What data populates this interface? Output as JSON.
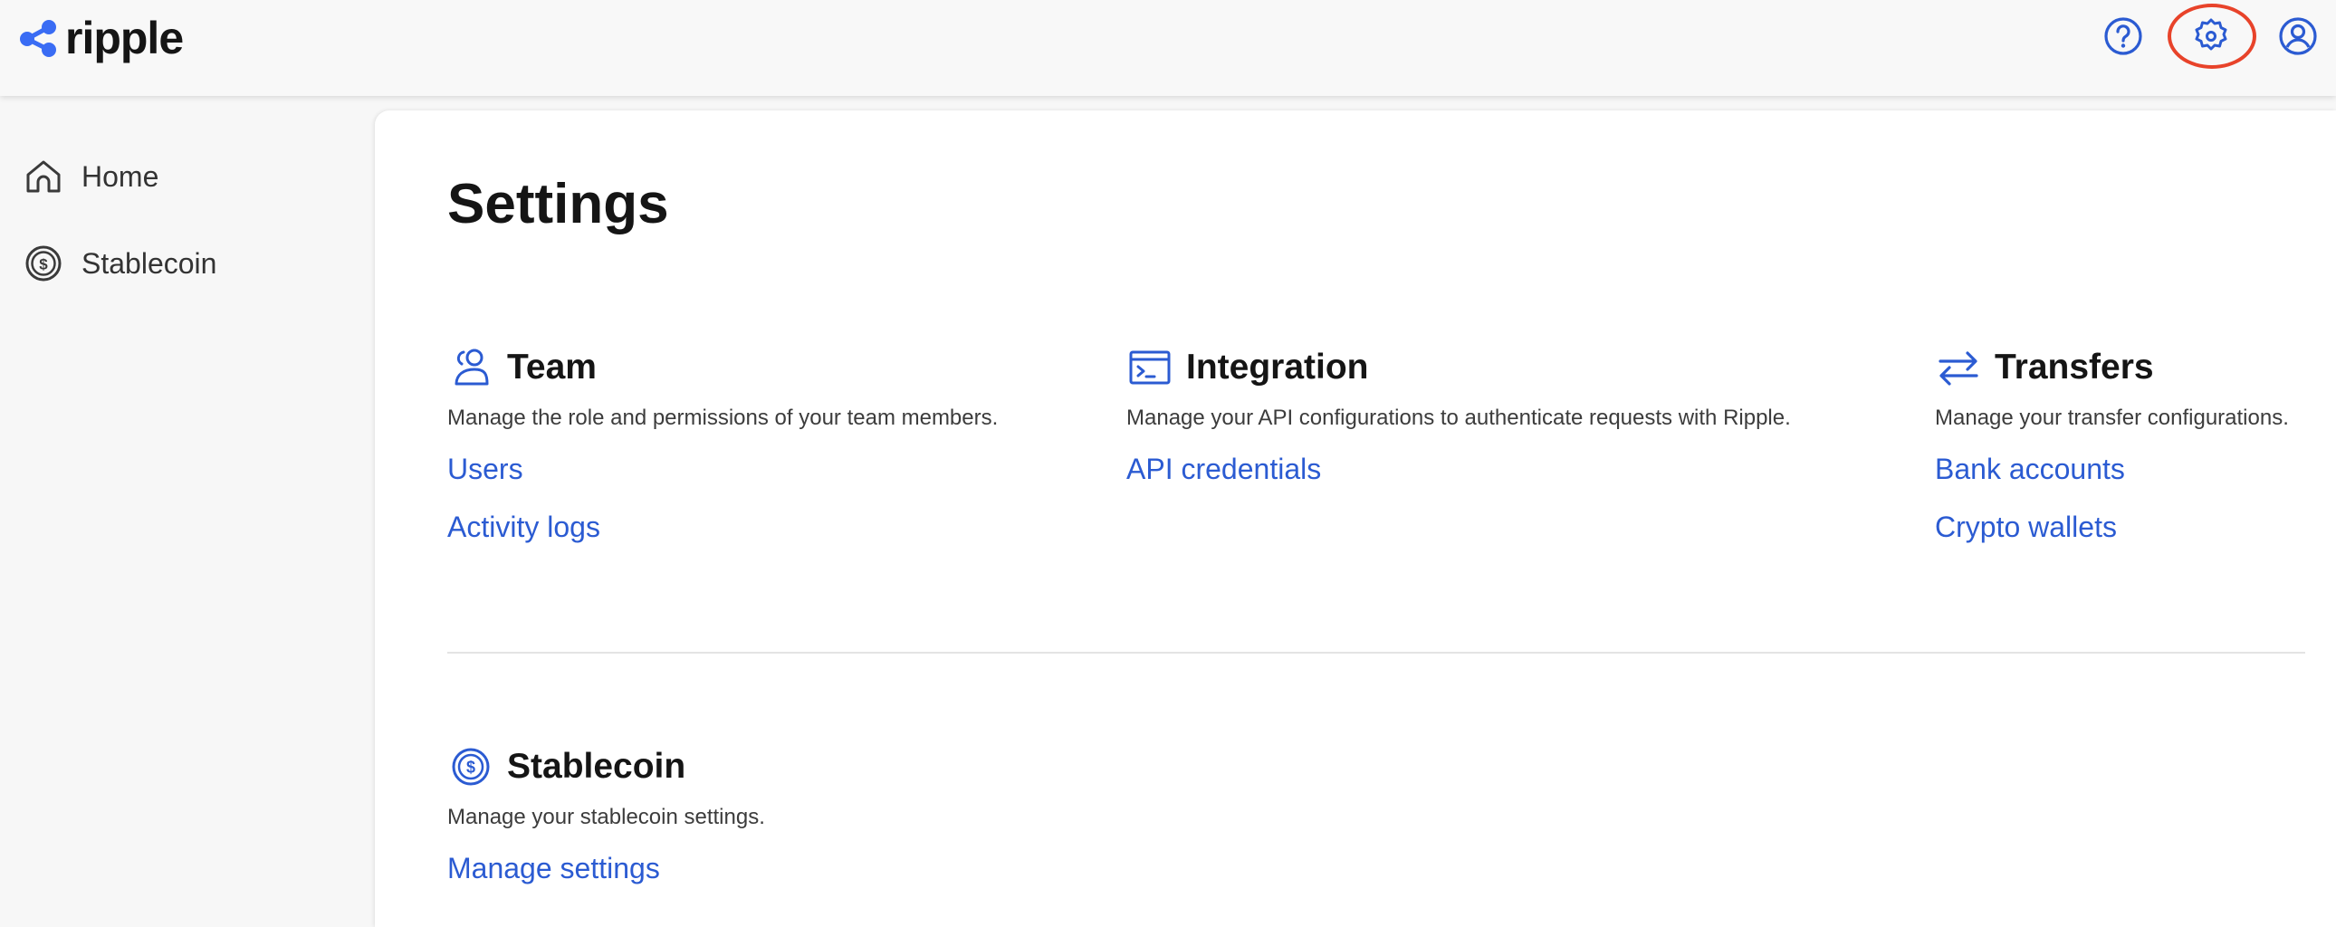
{
  "app": {
    "brand": "ripple"
  },
  "header": {
    "icons": [
      "help-icon",
      "gear-icon",
      "user-account-icon"
    ]
  },
  "sidebar": {
    "items": [
      {
        "label": "Home",
        "icon": "home-icon"
      },
      {
        "label": "Stablecoin",
        "icon": "stablecoin-icon"
      }
    ]
  },
  "main": {
    "title": "Settings",
    "sections": {
      "team": {
        "title": "Team",
        "description": "Manage the role and permissions of your team members.",
        "links": [
          "Users",
          "Activity logs"
        ]
      },
      "integration": {
        "title": "Integration",
        "description": "Manage your API configurations to authenticate requests with Ripple.",
        "links": [
          "API credentials"
        ]
      },
      "transfers": {
        "title": "Transfers",
        "description": "Manage your transfer configurations.",
        "links": [
          "Bank accounts",
          "Crypto wallets"
        ]
      },
      "stablecoin": {
        "title": "Stablecoin",
        "description": "Manage your stablecoin settings.",
        "links": [
          "Manage settings"
        ]
      }
    }
  },
  "colors": {
    "accent": "#2b5bd2",
    "highlight": "#e8432a",
    "logo": "#3a6cf4"
  }
}
